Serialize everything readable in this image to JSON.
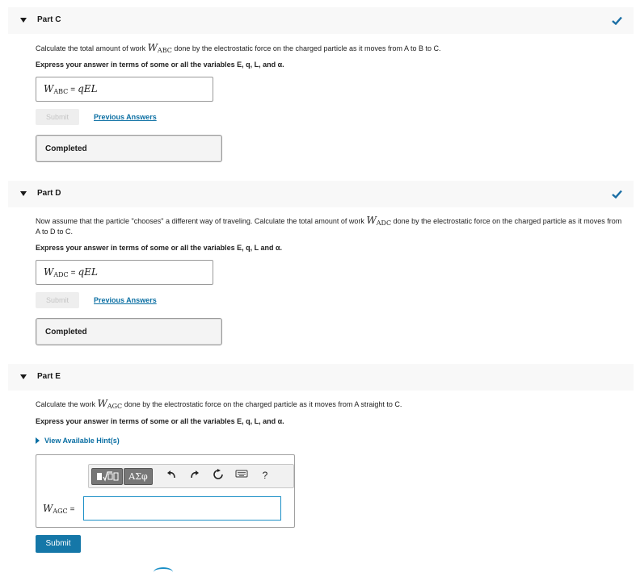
{
  "part_c": {
    "title": "Part C",
    "question_before": "Calculate the total amount of work ",
    "var_main": "W",
    "var_sub": "ABC",
    "question_after": " done by the electrostatic force on the charged particle as it moves from A to B to C.",
    "instruction": "Express your answer in terms of some or all the variables E, q, L, and α.",
    "answer_var": "W",
    "answer_sub": "ABC",
    "equals": "=",
    "answer_value": "qEL",
    "submit_label": "Submit",
    "previous_answers_label": "Previous Answers",
    "completed_label": "Completed"
  },
  "part_d": {
    "title": "Part D",
    "question_before": "Now assume that the particle \"chooses\" a different way of traveling. Calculate the total amount of work ",
    "var_main": "W",
    "var_sub": "ADC",
    "question_after": " done by the electrostatic force on the charged particle as it moves from A to D to C.",
    "instruction": "Express your answer in terms of some or all the variables E, q, L and α.",
    "answer_var": "W",
    "answer_sub": "ADC",
    "equals": "=",
    "answer_value": "qEL",
    "submit_label": "Submit",
    "previous_answers_label": "Previous Answers",
    "completed_label": "Completed"
  },
  "part_e": {
    "title": "Part E",
    "question_before": "Calculate the work ",
    "var_main": "W",
    "var_sub": "AGC",
    "question_after": " done by the electrostatic force on the charged particle as it moves from A straight to C.",
    "instruction": "Express your answer in terms of some or all the variables E, q, L, and α.",
    "hint_label": "View Available Hint(s)",
    "toolbar": {
      "greek_label": "ΑΣφ",
      "undo_icon": "undo-icon",
      "redo_icon": "redo-icon",
      "reset_icon": "reset-icon",
      "keyboard_icon": "keyboard-icon",
      "help_label": "?"
    },
    "answer_var": "W",
    "answer_sub": "AGC",
    "equals": "=",
    "answer_value": "",
    "submit_label": "Submit"
  },
  "colors": {
    "check": "#1b6fa5",
    "link": "#0b6fa3",
    "submit_active": "#1577a8",
    "input_focus": "#1b8fc6"
  }
}
